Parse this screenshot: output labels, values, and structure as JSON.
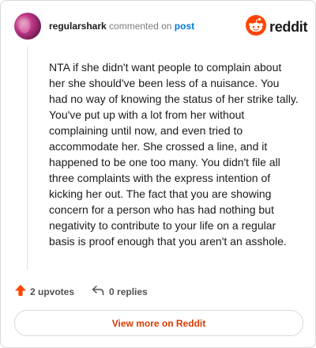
{
  "comment": {
    "author": "regularshark",
    "action_text": "commented on",
    "post_link": "post",
    "body": "NTA if she didn't want people to complain about her she should've been less of a nuisance. You had no way of knowing the status of her strike tally. You've put up with a lot from her without complaining until now, and even tried to accommodate her. She crossed a line, and it happened to be one too many. You didn't file all three complaints with the express intention of kicking her out. The fact that you are showing concern for a person who has had nothing but negativity to contribute to your life on a regular basis is proof enough that you aren't an asshole."
  },
  "brand": {
    "name": "reddit",
    "icon": "reddit-logo-icon",
    "color": "#ff4500"
  },
  "actions": {
    "upvotes_label": "2 upvotes",
    "upvote_icon": "upvote-arrow-icon",
    "replies_label": "0 replies",
    "reply_icon": "reply-arrow-icon"
  },
  "footer": {
    "view_more_label": "View more on Reddit"
  },
  "colors": {
    "upvote": "#ff4500",
    "link": "#0079d3",
    "view_more_text": "#d93a00"
  }
}
